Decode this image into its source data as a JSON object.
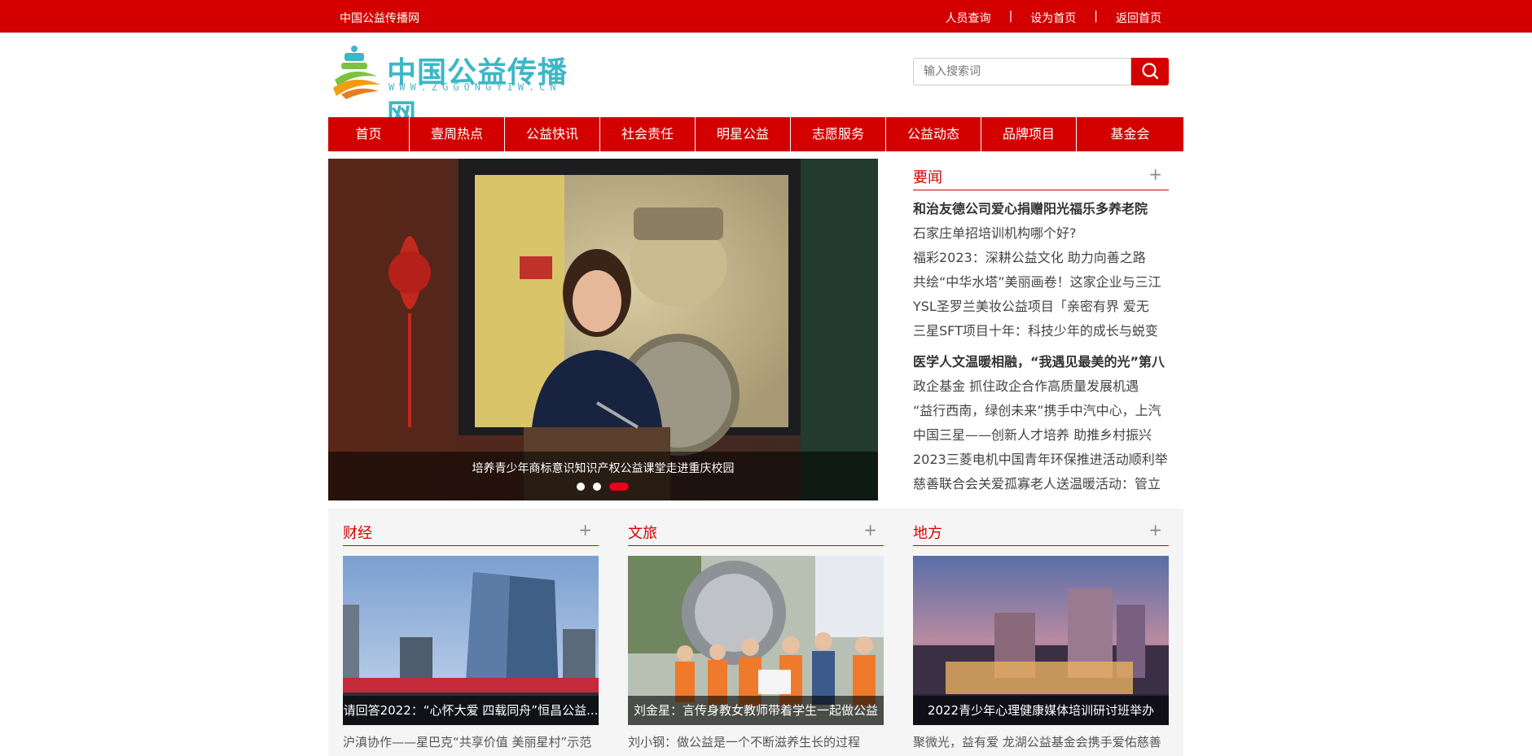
{
  "topbar": {
    "site_name": "中国公益传播网",
    "links": [
      "人员查询",
      "设为首页",
      "返回首页"
    ],
    "separator": "|"
  },
  "logo": {
    "text": "中国公益传播网",
    "url": "WWW.ZGGONGYIW.CN"
  },
  "search": {
    "placeholder": "输入搜索词",
    "icon": "search-icon"
  },
  "nav": [
    "首页",
    "壹周热点",
    "公益快讯",
    "社会责任",
    "明星公益",
    "志愿服务",
    "公益动态",
    "品牌项目",
    "基金会"
  ],
  "slider": {
    "caption": "培养青少年商标意识知识产权公益课堂走进重庆校园",
    "dot_count": 3,
    "active_dot": 3
  },
  "news": {
    "title": "要闻",
    "more": "+",
    "items": [
      "和治友德公司爱心捐赠阳光福乐多养老院",
      "石家庄单招培训机构哪个好?",
      "福彩2023：深耕公益文化 助力向善之路",
      "共绘“中华水塔”美丽画卷！这家企业与三江",
      "YSL圣罗兰美妆公益项目「亲密有界 爱无",
      "三星SFT项目十年：科技少年的成长与蜕变",
      "医学人文温暖相融，“我遇见最美的光”第八",
      "政企基金 抓住政企合作高质量发展机遇",
      "“益行西南，绿创未来”携手中汽中心，上汽",
      "中国三星——创新人才培养 助推乡村振兴",
      "2023三菱电机中国青年环保推进活动顺利举",
      "慈善联合会关爱孤寡老人送温暖活动：管立"
    ]
  },
  "sections": [
    {
      "title": "财经",
      "more": "+",
      "image_caption": "请回答2022：“心怀大爱 四载同舟”恒昌公益...",
      "below": "沪滇协作——星巴克“共享价值 美丽星村”示范"
    },
    {
      "title": "文旅",
      "more": "+",
      "image_caption": "刘金星：言传身教女教师带着学生一起做公益",
      "below": "刘小钢：做公益是一个不断滋养生长的过程"
    },
    {
      "title": "地方",
      "more": "+",
      "image_caption": "2022青少年心理健康媒体培训研讨班举办",
      "below": "聚微光，益有爱 龙湖公益基金会携手爱佑慈善"
    }
  ],
  "colors": {
    "brand_red": "#d40000",
    "logo_teal": "#3cb7c7"
  }
}
